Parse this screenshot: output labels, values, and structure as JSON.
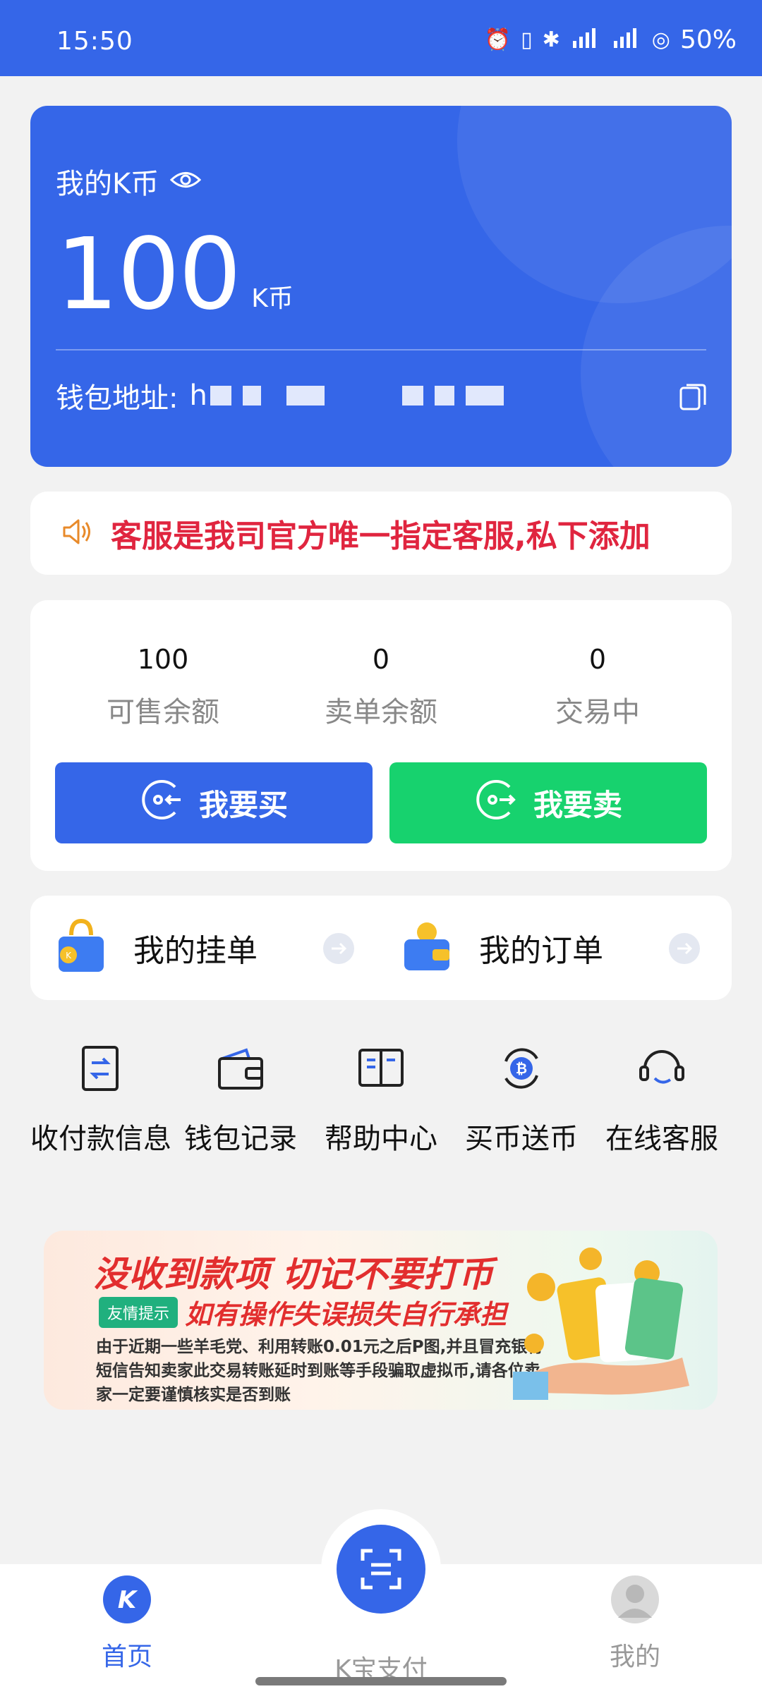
{
  "status_bar": {
    "time": "15:50",
    "network": "5G",
    "battery": "50%"
  },
  "wallet": {
    "title": "我的K币",
    "balance": "100",
    "unit": "K币",
    "address_label": "钱包地址:",
    "address_prefix": "h"
  },
  "notice": {
    "text": "客服是我司官方唯一指定客服,私下添加"
  },
  "stats": {
    "items": [
      {
        "value": "100",
        "label": "可售余额"
      },
      {
        "value": "0",
        "label": "卖单余额"
      },
      {
        "value": "0",
        "label": "交易中"
      }
    ],
    "buy_label": "我要买",
    "sell_label": "我要卖"
  },
  "orders": {
    "listings_label": "我的挂单",
    "orders_label": "我的订单"
  },
  "shortcuts": [
    {
      "label": "收付款信息",
      "icon": "payment-info-icon"
    },
    {
      "label": "钱包记录",
      "icon": "wallet-icon"
    },
    {
      "label": "帮助中心",
      "icon": "book-icon"
    },
    {
      "label": "买币送币",
      "icon": "bitcoin-exchange-icon"
    },
    {
      "label": "在线客服",
      "icon": "headset-icon"
    }
  ],
  "banner": {
    "headline": "没收到款项 切记不要打币",
    "tag": "友情提示",
    "subheadline": "如有操作失误损失自行承担",
    "body": "由于近期一些羊毛党、利用转账0.01元之后P图,并且冒充银行短信告知卖家此交易转账延时到账等手段骗取虚拟币,请各位卖家一定要谨慎核实是否到账"
  },
  "tabbar": {
    "home": "首页",
    "pay": "K宝支付",
    "me": "我的"
  },
  "colors": {
    "primary": "#3566e8",
    "sell": "#17d26e",
    "alert": "#e0253f"
  }
}
